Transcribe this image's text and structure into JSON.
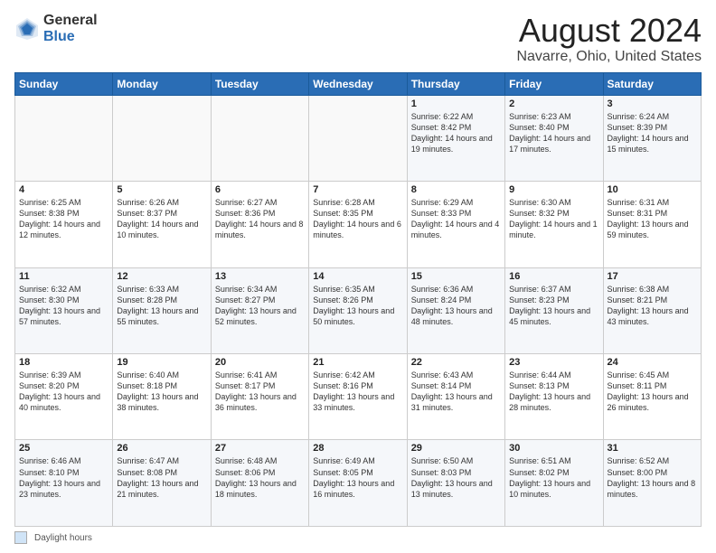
{
  "logo": {
    "general": "General",
    "blue": "Blue"
  },
  "title": "August 2024",
  "subtitle": "Navarre, Ohio, United States",
  "days_of_week": [
    "Sunday",
    "Monday",
    "Tuesday",
    "Wednesday",
    "Thursday",
    "Friday",
    "Saturday"
  ],
  "weeks": [
    [
      {
        "day": "",
        "info": ""
      },
      {
        "day": "",
        "info": ""
      },
      {
        "day": "",
        "info": ""
      },
      {
        "day": "",
        "info": ""
      },
      {
        "day": "1",
        "info": "Sunrise: 6:22 AM\nSunset: 8:42 PM\nDaylight: 14 hours and 19 minutes."
      },
      {
        "day": "2",
        "info": "Sunrise: 6:23 AM\nSunset: 8:40 PM\nDaylight: 14 hours and 17 minutes."
      },
      {
        "day": "3",
        "info": "Sunrise: 6:24 AM\nSunset: 8:39 PM\nDaylight: 14 hours and 15 minutes."
      }
    ],
    [
      {
        "day": "4",
        "info": "Sunrise: 6:25 AM\nSunset: 8:38 PM\nDaylight: 14 hours and 12 minutes."
      },
      {
        "day": "5",
        "info": "Sunrise: 6:26 AM\nSunset: 8:37 PM\nDaylight: 14 hours and 10 minutes."
      },
      {
        "day": "6",
        "info": "Sunrise: 6:27 AM\nSunset: 8:36 PM\nDaylight: 14 hours and 8 minutes."
      },
      {
        "day": "7",
        "info": "Sunrise: 6:28 AM\nSunset: 8:35 PM\nDaylight: 14 hours and 6 minutes."
      },
      {
        "day": "8",
        "info": "Sunrise: 6:29 AM\nSunset: 8:33 PM\nDaylight: 14 hours and 4 minutes."
      },
      {
        "day": "9",
        "info": "Sunrise: 6:30 AM\nSunset: 8:32 PM\nDaylight: 14 hours and 1 minute."
      },
      {
        "day": "10",
        "info": "Sunrise: 6:31 AM\nSunset: 8:31 PM\nDaylight: 13 hours and 59 minutes."
      }
    ],
    [
      {
        "day": "11",
        "info": "Sunrise: 6:32 AM\nSunset: 8:30 PM\nDaylight: 13 hours and 57 minutes."
      },
      {
        "day": "12",
        "info": "Sunrise: 6:33 AM\nSunset: 8:28 PM\nDaylight: 13 hours and 55 minutes."
      },
      {
        "day": "13",
        "info": "Sunrise: 6:34 AM\nSunset: 8:27 PM\nDaylight: 13 hours and 52 minutes."
      },
      {
        "day": "14",
        "info": "Sunrise: 6:35 AM\nSunset: 8:26 PM\nDaylight: 13 hours and 50 minutes."
      },
      {
        "day": "15",
        "info": "Sunrise: 6:36 AM\nSunset: 8:24 PM\nDaylight: 13 hours and 48 minutes."
      },
      {
        "day": "16",
        "info": "Sunrise: 6:37 AM\nSunset: 8:23 PM\nDaylight: 13 hours and 45 minutes."
      },
      {
        "day": "17",
        "info": "Sunrise: 6:38 AM\nSunset: 8:21 PM\nDaylight: 13 hours and 43 minutes."
      }
    ],
    [
      {
        "day": "18",
        "info": "Sunrise: 6:39 AM\nSunset: 8:20 PM\nDaylight: 13 hours and 40 minutes."
      },
      {
        "day": "19",
        "info": "Sunrise: 6:40 AM\nSunset: 8:18 PM\nDaylight: 13 hours and 38 minutes."
      },
      {
        "day": "20",
        "info": "Sunrise: 6:41 AM\nSunset: 8:17 PM\nDaylight: 13 hours and 36 minutes."
      },
      {
        "day": "21",
        "info": "Sunrise: 6:42 AM\nSunset: 8:16 PM\nDaylight: 13 hours and 33 minutes."
      },
      {
        "day": "22",
        "info": "Sunrise: 6:43 AM\nSunset: 8:14 PM\nDaylight: 13 hours and 31 minutes."
      },
      {
        "day": "23",
        "info": "Sunrise: 6:44 AM\nSunset: 8:13 PM\nDaylight: 13 hours and 28 minutes."
      },
      {
        "day": "24",
        "info": "Sunrise: 6:45 AM\nSunset: 8:11 PM\nDaylight: 13 hours and 26 minutes."
      }
    ],
    [
      {
        "day": "25",
        "info": "Sunrise: 6:46 AM\nSunset: 8:10 PM\nDaylight: 13 hours and 23 minutes."
      },
      {
        "day": "26",
        "info": "Sunrise: 6:47 AM\nSunset: 8:08 PM\nDaylight: 13 hours and 21 minutes."
      },
      {
        "day": "27",
        "info": "Sunrise: 6:48 AM\nSunset: 8:06 PM\nDaylight: 13 hours and 18 minutes."
      },
      {
        "day": "28",
        "info": "Sunrise: 6:49 AM\nSunset: 8:05 PM\nDaylight: 13 hours and 16 minutes."
      },
      {
        "day": "29",
        "info": "Sunrise: 6:50 AM\nSunset: 8:03 PM\nDaylight: 13 hours and 13 minutes."
      },
      {
        "day": "30",
        "info": "Sunrise: 6:51 AM\nSunset: 8:02 PM\nDaylight: 13 hours and 10 minutes."
      },
      {
        "day": "31",
        "info": "Sunrise: 6:52 AM\nSunset: 8:00 PM\nDaylight: 13 hours and 8 minutes."
      }
    ]
  ],
  "legend": {
    "box_label": "Daylight hours"
  }
}
